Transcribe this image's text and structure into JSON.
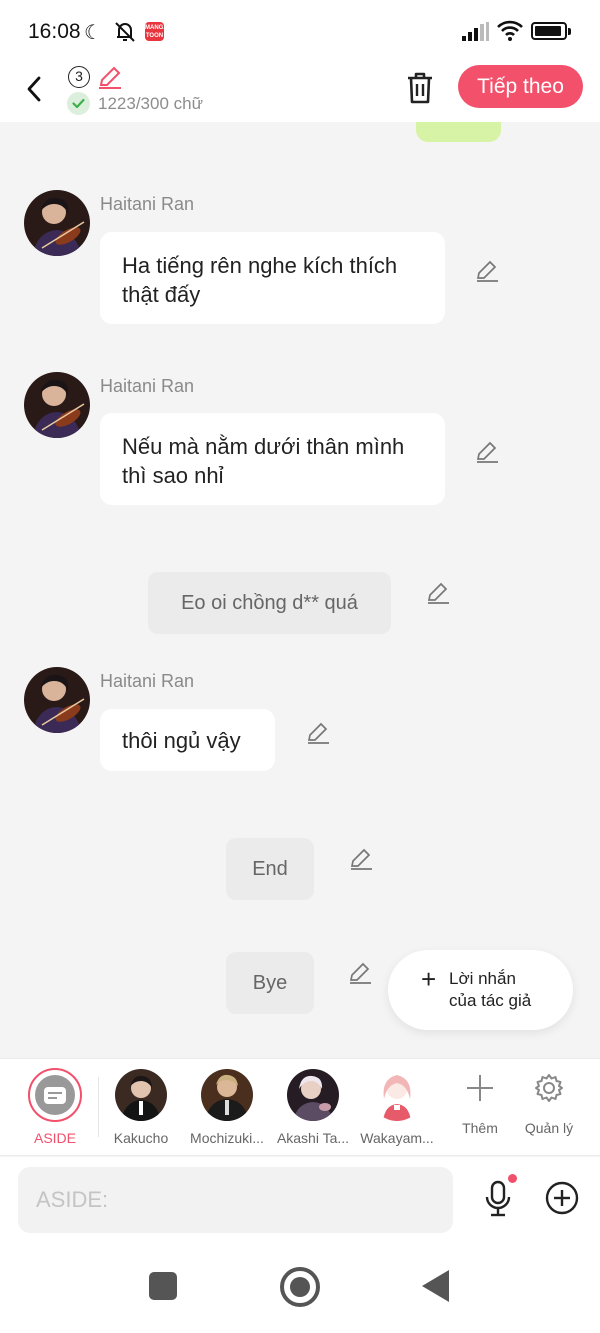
{
  "status_bar": {
    "time": "16:08",
    "app_badge": "MANGA TOON"
  },
  "header": {
    "chapter_number": "3",
    "word_count": "1223/300 chữ",
    "next_label": "Tiếp theo",
    "accent_color": "#f2506b"
  },
  "messages": [
    {
      "sender": "Haitani Ran",
      "text": "Ha tiếng rên nghe kích thích thật đấy"
    },
    {
      "sender": "Haitani Ran",
      "text": "Nếu mà nằm dưới thân mình thì sao nhỉ"
    },
    {
      "narration": "Eo oi chồng d** quá"
    },
    {
      "sender": "Haitani Ran",
      "text": "thôi ngủ vậy"
    },
    {
      "narration": "End"
    },
    {
      "narration": "Bye"
    }
  ],
  "author_note": {
    "label_line1": "Lời nhắn",
    "label_line2": "của tác giả"
  },
  "characters": [
    {
      "name": "ASIDE",
      "active": true
    },
    {
      "name": "Kakucho"
    },
    {
      "name": "Mochizuki..."
    },
    {
      "name": "Akashi Ta..."
    },
    {
      "name": "Wakayam..."
    }
  ],
  "add_character_label": "Thêm",
  "manage_label": "Quản lý",
  "input": {
    "placeholder": "ASIDE:"
  }
}
